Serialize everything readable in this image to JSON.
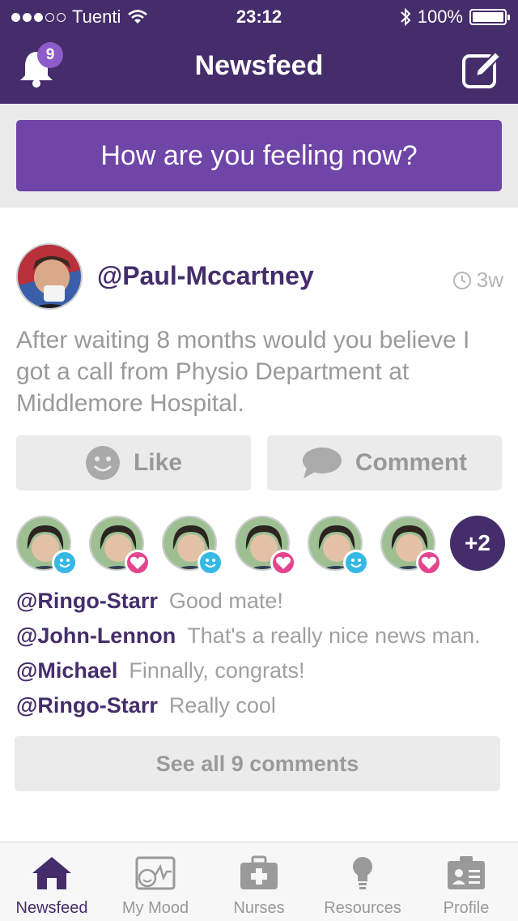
{
  "status_bar": {
    "carrier": "Tuenti",
    "time": "23:12",
    "battery": "100%",
    "battery_level": 1.0
  },
  "header": {
    "title": "Newsfeed",
    "notification_count": "9",
    "left_icon": "bell-icon",
    "right_icon": "compose-icon"
  },
  "feeling_button": "How are you feeling now?",
  "post": {
    "author": "@Paul-Mccartney",
    "time_ago": "3w",
    "text": "After waiting 8 months would you believe I got a call from Physio Department at Middlemore Hospital.",
    "like_label": "Like",
    "comment_label": "Comment",
    "reactions": [
      {
        "type": "smile"
      },
      {
        "type": "heart"
      },
      {
        "type": "smile"
      },
      {
        "type": "heart"
      },
      {
        "type": "smile"
      },
      {
        "type": "heart"
      }
    ],
    "more_reactions": "+2",
    "comments": [
      {
        "user": "@Ringo-Starr",
        "text": "Good mate!"
      },
      {
        "user": "@John-Lennon",
        "text": "That's a really nice news man."
      },
      {
        "user": "@Michael",
        "text": "Finnally, congrats!"
      },
      {
        "user": "@Ringo-Starr",
        "text": "Really cool"
      }
    ],
    "see_all": "See all 9 comments"
  },
  "tabs": [
    {
      "label": "Newsfeed",
      "icon": "home-icon",
      "active": true
    },
    {
      "label": "My Mood",
      "icon": "mood-chart-icon",
      "active": false
    },
    {
      "label": "Nurses",
      "icon": "medical-kit-icon",
      "active": false
    },
    {
      "label": "Resources",
      "icon": "lightbulb-icon",
      "active": false
    },
    {
      "label": "Profile",
      "icon": "id-card-icon",
      "active": false
    }
  ],
  "colors": {
    "brand": "#452d6b",
    "accent": "#6f45a8",
    "smile": "#35b9e4",
    "heart": "#e2458e"
  }
}
